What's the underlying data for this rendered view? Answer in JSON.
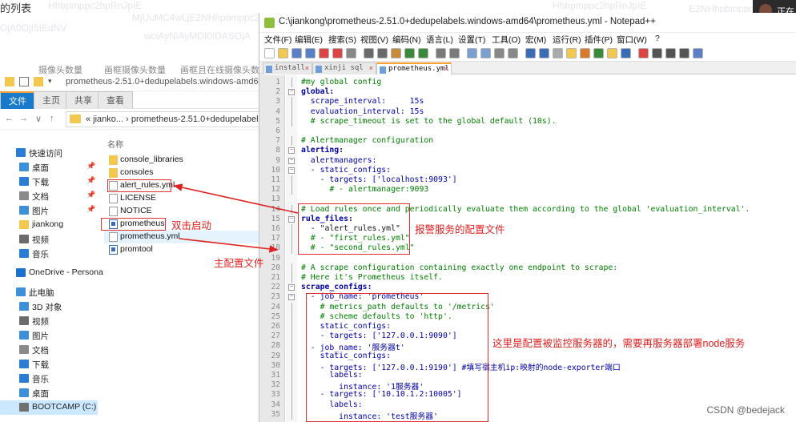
{
  "background": {
    "title_partial": "的列表",
    "watermarks": [
      "Hhbpmppc2hpRnJpIE",
      "MjUuMC4wLjE2NHhpbmppc2hpRnJpIE",
      "Hhbpmppc2hpRnJpIE",
      "E2NHhpbmppc2hpRnJpIE",
      "wciAyNiAyMDI0IDASOjA",
      "OjA0OjI5IEdNV"
    ],
    "columns": [
      "摄像头数量",
      "画框摄像头数量",
      "画框且在线摄像头数"
    ],
    "right_label": "正在"
  },
  "explorer": {
    "titlebar_path": "prometheus-2.51.0+dedupelabels.windows-amd64",
    "ribbon_tabs": [
      "文件",
      "主页",
      "共享",
      "查看"
    ],
    "address_crumbs": "« jianko... › prometheus-2.51.0+dedupelabels.wi",
    "nav_items": [
      {
        "label": "快速访问",
        "icon": "star-icon",
        "color": "#2b7cd3",
        "pinned": false
      },
      {
        "label": "桌面",
        "icon": "desktop-icon",
        "color": "#3d8fd8",
        "pinned": true
      },
      {
        "label": "下载",
        "icon": "download-icon",
        "color": "#2b7cd3",
        "pinned": true
      },
      {
        "label": "文档",
        "icon": "documents-icon",
        "color": "#8a8a8a",
        "pinned": true
      },
      {
        "label": "图片",
        "icon": "pictures-icon",
        "color": "#3d8fd8",
        "pinned": true
      },
      {
        "label": "jiankong",
        "icon": "folder-icon",
        "color": "#f3c84e",
        "pinned": false
      },
      {
        "label": "视频",
        "icon": "videos-icon",
        "color": "#6b6b6b",
        "pinned": false
      },
      {
        "label": "音乐",
        "icon": "music-icon",
        "color": "#2b7cd3",
        "pinned": false
      },
      {
        "label": "OneDrive - Persona",
        "icon": "onedrive-icon",
        "color": "#1a73c8",
        "pinned": false
      },
      {
        "label": "此电脑",
        "icon": "computer-icon",
        "color": "#3d8fd8",
        "pinned": false
      },
      {
        "label": "3D 对象",
        "icon": "3d-objects-icon",
        "color": "#3d8fd8",
        "pinned": false
      },
      {
        "label": "视频",
        "icon": "videos-icon",
        "color": "#6b6b6b",
        "pinned": false
      },
      {
        "label": "图片",
        "icon": "pictures-icon",
        "color": "#3d8fd8",
        "pinned": false
      },
      {
        "label": "文档",
        "icon": "documents-icon",
        "color": "#8a8a8a",
        "pinned": false
      },
      {
        "label": "下载",
        "icon": "download-icon",
        "color": "#2b7cd3",
        "pinned": false
      },
      {
        "label": "音乐",
        "icon": "music-icon",
        "color": "#2b7cd3",
        "pinned": false
      },
      {
        "label": "桌面",
        "icon": "desktop-icon",
        "color": "#3d8fd8",
        "pinned": false
      },
      {
        "label": "BOOTCAMP (C:)",
        "icon": "drive-icon",
        "color": "#707070",
        "pinned": false
      }
    ],
    "column_header": "名称",
    "files": [
      {
        "name": "console_libraries",
        "type": "folder"
      },
      {
        "name": "consoles",
        "type": "folder"
      },
      {
        "name": "alert_rules.yml",
        "type": "doc"
      },
      {
        "name": "LICENSE",
        "type": "doc"
      },
      {
        "name": "NOTICE",
        "type": "doc"
      },
      {
        "name": "prometheus",
        "type": "exe"
      },
      {
        "name": "prometheus.yml",
        "type": "doc"
      },
      {
        "name": "promtool",
        "type": "exe"
      }
    ]
  },
  "annotations": {
    "double_click": "双击启动",
    "main_config": "主配置文件",
    "alert_config": "报警服务的配置文件",
    "monitor_config": "这里是配置被监控服务器的，需要再服务器部署node服务"
  },
  "notepad": {
    "title": "C:\\jiankong\\prometheus-2.51.0+dedupelabels.windows-amd64\\prometheus.yml - Notepad++",
    "menu": [
      "文件(F)",
      "编辑(E)",
      "搜索(S)",
      "视图(V)",
      "编码(N)",
      "语言(L)",
      "设置(T)",
      "工具(O)",
      "宏(M)",
      "运行(R)",
      "插件(P)",
      "窗口(W)",
      "?"
    ],
    "tabs": [
      "install",
      "xinji sql",
      "prometheus.yml"
    ],
    "active_tab": "prometheus.yml",
    "lines": [
      {
        "n": "1",
        "text": "#my global config",
        "cls": "c-comment"
      },
      {
        "n": "2",
        "text": "global:",
        "cls": "c-key"
      },
      {
        "n": "3",
        "text": "  scrape_interval:     15s",
        "cls": "c-keyn"
      },
      {
        "n": "4",
        "text": "  evaluation_interval: 15s",
        "cls": "c-keyn"
      },
      {
        "n": "5",
        "text": "  # scrape_timeout is set to the global default (10s).",
        "cls": "c-comment"
      },
      {
        "n": "6",
        "text": "",
        "cls": "c-val"
      },
      {
        "n": "7",
        "text": "# Alertmanager configuration",
        "cls": "c-comment"
      },
      {
        "n": "8",
        "text": "alerting:",
        "cls": "c-key"
      },
      {
        "n": "9",
        "text": "  alertmanagers:",
        "cls": "c-keyn"
      },
      {
        "n": "10",
        "text": "  - static_configs:",
        "cls": "c-keyn"
      },
      {
        "n": "11",
        "text": "    - targets: ['localhost:9093']",
        "cls": "c-keyn"
      },
      {
        "n": "12",
        "text": "      # - alertmanager:9093",
        "cls": "c-comment"
      },
      {
        "n": "13",
        "text": "",
        "cls": "c-val"
      },
      {
        "n": "14",
        "text": "# Load rules once and periodically evaluate them according to the global 'evaluation_interval'.",
        "cls": "c-comment"
      },
      {
        "n": "15",
        "text": "rule_files:",
        "cls": "c-key"
      },
      {
        "n": "16",
        "text": "  - \"alert_rules.yml\"",
        "cls": "c-val"
      },
      {
        "n": "17",
        "text": "  # - \"first_rules.yml\"",
        "cls": "c-comment"
      },
      {
        "n": "18",
        "text": "  # - \"second_rules.yml\"",
        "cls": "c-comment"
      },
      {
        "n": "19",
        "text": "",
        "cls": "c-val"
      },
      {
        "n": "20",
        "text": "# A scrape configuration containing exactly one endpoint to scrape:",
        "cls": "c-comment"
      },
      {
        "n": "21",
        "text": "# Here it's Prometheus itself.",
        "cls": "c-comment"
      },
      {
        "n": "22",
        "text": "scrape_configs:",
        "cls": "c-key"
      },
      {
        "n": "23",
        "text": "  - job_name: 'prometheus'",
        "cls": "c-keyn"
      },
      {
        "n": "24",
        "text": "    # metrics_path defaults to '/metrics'",
        "cls": "c-comment"
      },
      {
        "n": "25",
        "text": "    # scheme defaults to 'http'.",
        "cls": "c-comment"
      },
      {
        "n": "26",
        "text": "    static_configs:",
        "cls": "c-keyn"
      },
      {
        "n": "27",
        "text": "    - targets: ['127.0.0.1:9090']",
        "cls": "c-keyn"
      },
      {
        "n": "28",
        "text": "  - job_name: '服务器t'",
        "cls": "c-keyn"
      },
      {
        "n": "29",
        "text": "    static_configs:",
        "cls": "c-keyn"
      },
      {
        "n": "30",
        "text": "    - targets: ['127.0.0.1:9190'] #填写宿主机ip:映射的node-exporter端口",
        "cls": "c-keyn"
      },
      {
        "n": "31",
        "text": "      labels:",
        "cls": "c-keyn"
      },
      {
        "n": "32",
        "text": "        instance: '1服务器'",
        "cls": "c-keyn"
      },
      {
        "n": "33",
        "text": "    - targets: ['10.10.1.2:10005']",
        "cls": "c-keyn"
      },
      {
        "n": "34",
        "text": "      labels:",
        "cls": "c-keyn"
      },
      {
        "n": "35",
        "text": "        instance: 'test服务器'",
        "cls": "c-keyn"
      }
    ]
  },
  "watermark": "CSDN @bedejack"
}
